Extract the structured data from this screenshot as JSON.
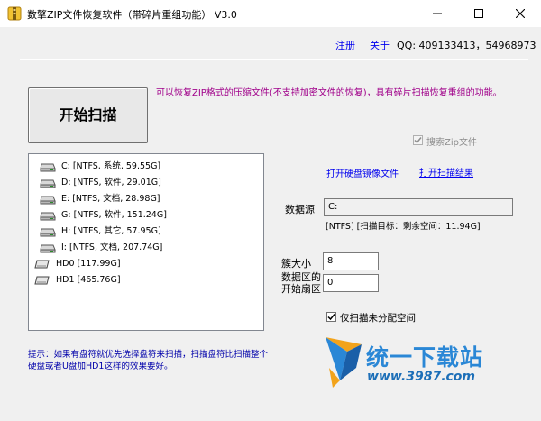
{
  "window": {
    "title": "数擎ZIP文件恢复软件（带碎片重组功能） V3.0",
    "controls": {
      "minimize": "—",
      "maximize": "☐",
      "close": "✕"
    }
  },
  "toplinks": {
    "register": "注册",
    "about": "关于",
    "qq": "QQ: 409133413，54968973"
  },
  "scan_button": "开始扫描",
  "notice": "可以恢复ZIP格式的压缩文件(不支持加密文件的恢复)，具有碎片扫描恢复重组的功能。",
  "search_zip": {
    "label": "搜索Zip文件",
    "checked": true,
    "disabled": true
  },
  "drives": [
    {
      "label": "C:  [NTFS, 系统, 59.55G]",
      "kind": "partition"
    },
    {
      "label": "D:  [NTFS, 软件, 29.01G]",
      "kind": "partition"
    },
    {
      "label": "E:  [NTFS, 文档, 28.98G]",
      "kind": "partition"
    },
    {
      "label": "G:  [NTFS, 软件, 151.24G]",
      "kind": "partition"
    },
    {
      "label": "H:  [NTFS, 其它, 57.95G]",
      "kind": "partition"
    },
    {
      "label": "I:  [NTFS, 文档, 207.74G]",
      "kind": "partition"
    },
    {
      "label": "HD0  [117.99G]",
      "kind": "disk"
    },
    {
      "label": "HD1  [465.76G]",
      "kind": "disk"
    }
  ],
  "hint": "提示：如果有盘符就优先选择盘符来扫描，扫描盘符比扫描整个硬盘或者U盘加HD1这样的效果要好。",
  "links": {
    "open_image": "打开硬盘镜像文件",
    "open_result": "打开扫描结果"
  },
  "source": {
    "label": "数据源",
    "value": "C:",
    "info": "[NTFS]  [扫描目标：剩余空间：11.94G]"
  },
  "cluster": {
    "label": "簇大小",
    "value": "8"
  },
  "start_sector": {
    "label_line1": "数据区的",
    "label_line2": "开始扇区",
    "value": "0"
  },
  "unallocated": {
    "label": "仅扫描未分配空间",
    "checked": true
  },
  "watermark": {
    "name": "统一下载站",
    "url": "www.3987.com"
  },
  "colors": {
    "notice": "#a0008a",
    "hint": "#0000aa",
    "link": "#0000ee",
    "logo": "#2a87d6"
  }
}
